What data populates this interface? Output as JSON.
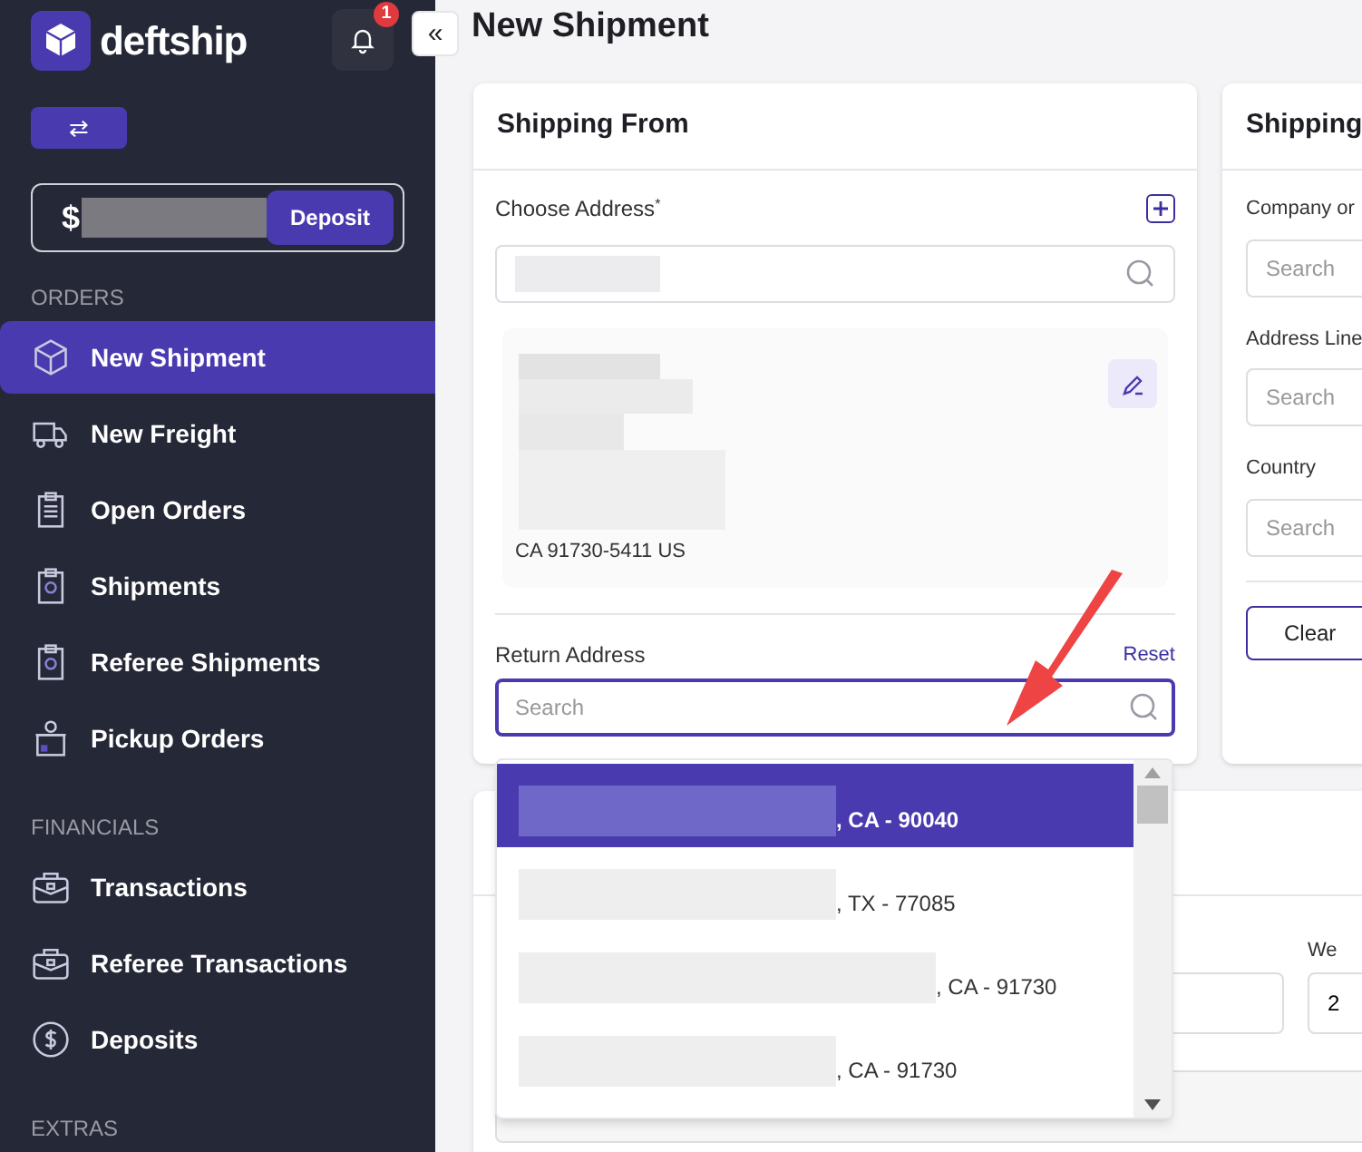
{
  "brand": {
    "name": "deftship"
  },
  "notifications": {
    "count": "1"
  },
  "collapse_button": {
    "label": "«"
  },
  "switch_button": {
    "label": "⇄"
  },
  "balance": {
    "currency": "$",
    "button": "Deposit"
  },
  "sidebar": {
    "sections": [
      {
        "title": "ORDERS",
        "items": [
          {
            "label": "New Shipment",
            "selected": true
          },
          {
            "label": "New Freight",
            "selected": false
          },
          {
            "label": "Open Orders",
            "selected": false
          },
          {
            "label": "Shipments",
            "selected": false
          },
          {
            "label": "Referee Shipments",
            "selected": false
          },
          {
            "label": "Pickup Orders",
            "selected": false
          }
        ]
      },
      {
        "title": "FINANCIALS",
        "items": [
          {
            "label": "Transactions",
            "selected": false
          },
          {
            "label": "Referee Transactions",
            "selected": false
          },
          {
            "label": "Deposits",
            "selected": false
          }
        ]
      },
      {
        "title": "EXTRAS"
      }
    ]
  },
  "page_title": "New Shipment",
  "shipping_from": {
    "title": "Shipping From",
    "choose_address_label": "Choose Address",
    "required_mark": "*",
    "address_line": "CA 91730-5411 US",
    "return_address_label": "Return Address",
    "reset_link": "Reset",
    "return_search_placeholder": "Search",
    "dropdown": [
      {
        "text": ", CA - 90040",
        "selected": true
      },
      {
        "text": ", TX - 77085",
        "selected": false
      },
      {
        "text": ", CA - 91730",
        "selected": false
      },
      {
        "text": ", CA - 91730",
        "selected": false
      }
    ]
  },
  "shipping_to": {
    "title": "Shipping",
    "fields": [
      {
        "label": "Company or",
        "placeholder": "Search"
      },
      {
        "label": "Address Line",
        "placeholder": "Search"
      },
      {
        "label": "Country",
        "placeholder": "Search"
      }
    ],
    "button": "Clear"
  },
  "package": {
    "field_label": "We",
    "field_value": "2"
  }
}
